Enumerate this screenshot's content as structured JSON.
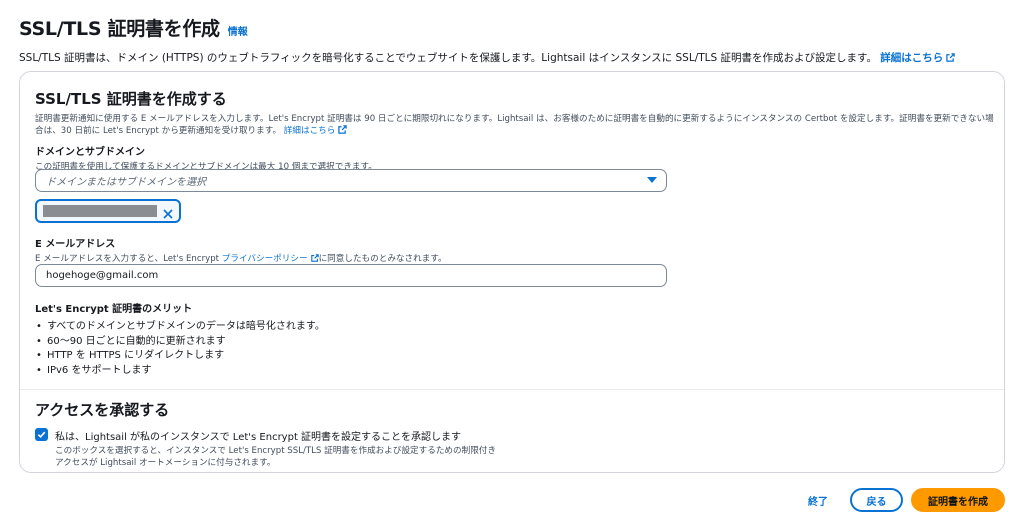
{
  "header": {
    "title": "SSL/TLS 証明書を作成",
    "info": "情報",
    "description": "SSL/TLS 証明書は、ドメイン (HTTPS) のウェブトラフィックを暗号化することでウェブサイトを保護します。Lightsail はインスタンスに SSL/TLS 証明書を作成および設定します。",
    "learn_more": "詳細はこちら"
  },
  "create_section": {
    "title": "SSL/TLS 証明書を作成する",
    "description": "証明書更新通知に使用する E メールアドレスを入力します。Let's Encrypt 証明書は 90 日ごとに期限切れになります。Lightsail は、お客様のために証明書を自動的に更新するようにインスタンスの Certbot を設定します。証明書を更新できない場合は、30 日前に Let's Encrypt から更新通知を受け取ります。",
    "learn_more": "詳細はこちら",
    "domains": {
      "label": "ドメインとサブドメイン",
      "hint": "この証明書を使用して保護するドメインとサブドメインは最大 10 個まで選択できます。",
      "placeholder": "ドメインまたはサブドメインを選択"
    },
    "email": {
      "label": "E メールアドレス",
      "hint_prefix": "E メールアドレスを入力すると、Let's Encrypt ",
      "hint_link": "プライバシーポリシー",
      "hint_suffix": "に同意したものとみなされます。",
      "value": "hogehoge@gmail.com"
    },
    "benefits": {
      "title": "Let's Encrypt 証明書のメリット",
      "items": [
        "すべてのドメインとサブドメインのデータは暗号化されます。",
        "60～90 日ごとに自動的に更新されます",
        "HTTP を HTTPS にリダイレクトします",
        "IPv6 をサポートします"
      ]
    }
  },
  "ack_section": {
    "title": "アクセスを承認する",
    "checkbox_label": "私は、Lightsail が私のインスタンスで Let's Encrypt 証明書を設定することを承認します",
    "checkbox_desc_1": "このボックスを選択すると、インスタンスで Let's Encrypt SSL/TLS 証明書を作成および設定するための制限付き",
    "checkbox_desc_2": "アクセスが Lightsail オートメーションに付与されます。",
    "checked": true
  },
  "footer": {
    "cancel": "終了",
    "back": "戻る",
    "create": "証明書を作成"
  },
  "colors": {
    "link": "#0972d3",
    "primary": "#ff9900"
  }
}
